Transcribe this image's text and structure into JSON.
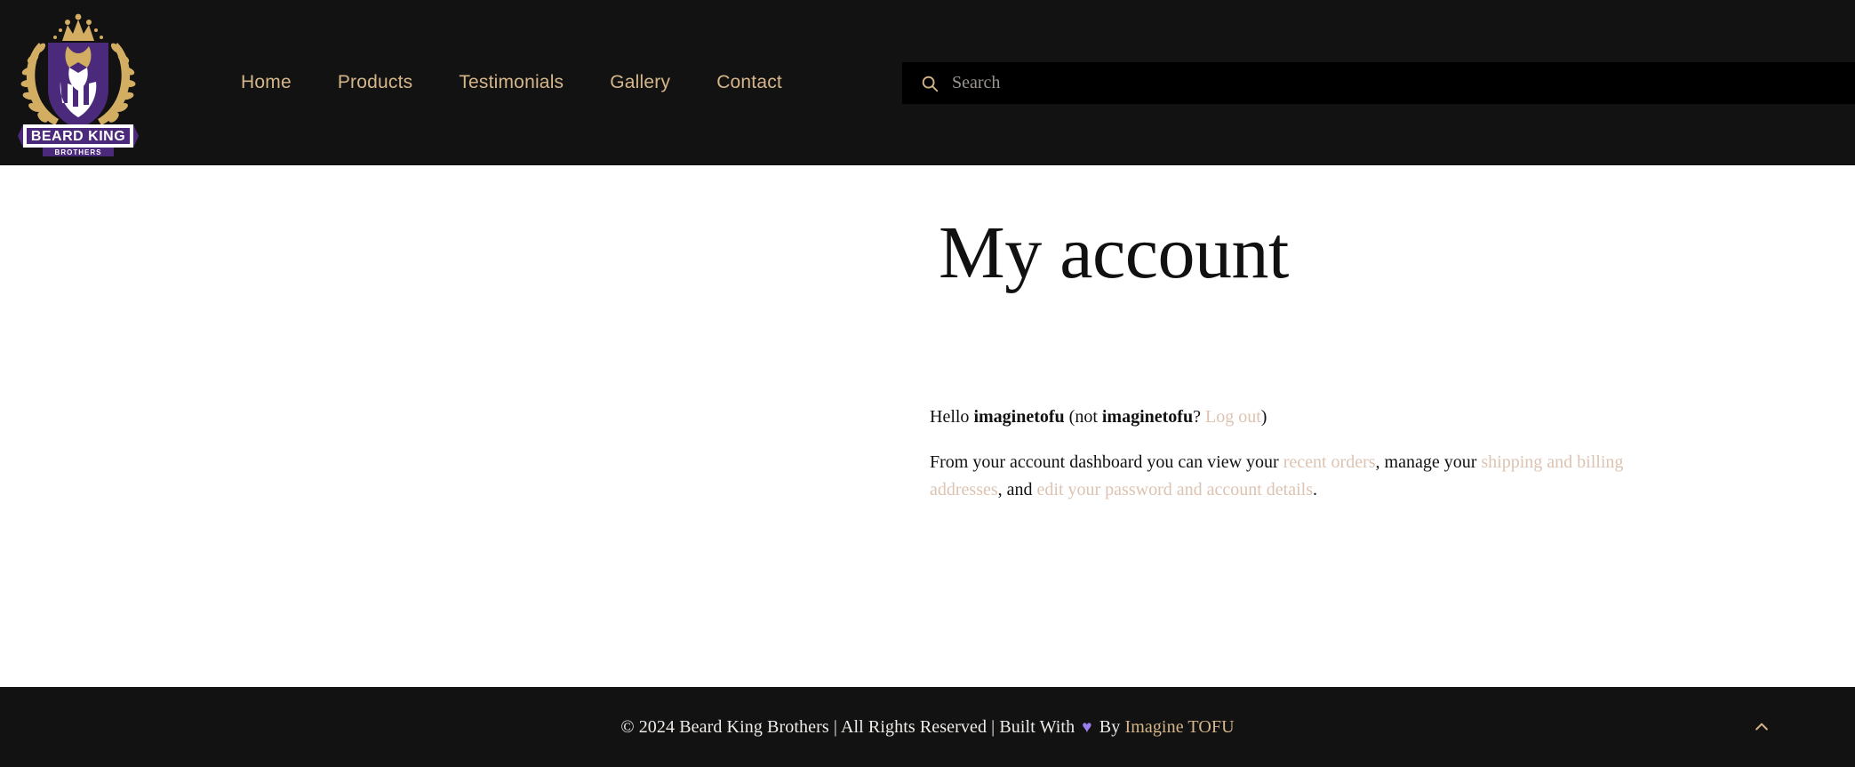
{
  "header": {
    "logo": {
      "name": "beard-king-brothers-logo",
      "banner_text": "BEARD KING",
      "sub_banner_text": "BROTHERS",
      "colors": {
        "crest_purple": "#4b2a7b",
        "wreath_gold": "#d3ae62",
        "white": "#ffffff"
      }
    },
    "nav": [
      {
        "label": "Home"
      },
      {
        "label": "Products"
      },
      {
        "label": "Testimonials"
      },
      {
        "label": "Gallery"
      },
      {
        "label": "Contact"
      }
    ],
    "search": {
      "icon": "search-icon",
      "placeholder": "Search",
      "value": ""
    },
    "background_color": "#121212",
    "nav_link_color": "#d5b68a"
  },
  "main": {
    "title": "My account",
    "greeting": {
      "prefix": "Hello ",
      "username": "imaginetofu",
      "middle": " (not ",
      "username2": "imaginetofu",
      "question": "? ",
      "logout_label": "Log out",
      "suffix": ")"
    },
    "intro": {
      "part1": "From your account dashboard you can view your ",
      "link_recent_orders": "recent orders",
      "part2": ", manage your ",
      "link_addresses": "shipping and billing addresses",
      "part3": ", and ",
      "link_edit_details": "edit your password and account details",
      "part4": "."
    },
    "link_color": "#dcc3b2",
    "background_color": "#ffffff"
  },
  "footer": {
    "copyright": "© 2024 Beard King Brothers | All Rights Reserved | Built With ",
    "heart": "♥",
    "by": " By ",
    "credit_link": "Imagine TOFU",
    "back_to_top_icon": "chevron-up-icon",
    "background_color": "#121212",
    "accent_color": "#d5b68a",
    "heart_color": "#9b7ff0"
  }
}
